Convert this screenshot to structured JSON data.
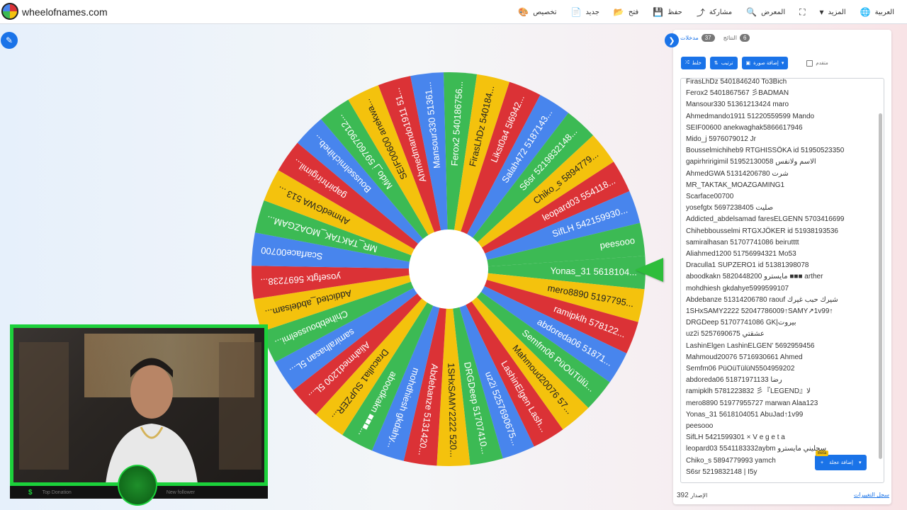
{
  "topbar": {
    "site_name": "wheelofnames.com",
    "menu": [
      {
        "label": "العربية",
        "icon": "globe-icon",
        "glyph": "🌐"
      },
      {
        "label": "المزيد",
        "icon": "chevron-down-icon",
        "glyph": "▾"
      },
      {
        "label": "",
        "icon": "fullscreen-icon",
        "glyph": "⛶"
      },
      {
        "label": "المعرض",
        "icon": "search-icon",
        "glyph": "🔍"
      },
      {
        "label": "مشاركة",
        "icon": "share-icon",
        "glyph": "⤴"
      },
      {
        "label": "حفظ",
        "icon": "save-icon",
        "glyph": "💾"
      },
      {
        "label": "فتح",
        "icon": "folder-open-icon",
        "glyph": "📂"
      },
      {
        "label": "جديد",
        "icon": "new-file-icon",
        "glyph": "📄"
      },
      {
        "label": "تخصيص",
        "icon": "palette-icon",
        "glyph": "🎨"
      }
    ]
  },
  "panel": {
    "tabs": {
      "entries_label": "مدخلات",
      "entries_count": "37",
      "results_label": "النتائج",
      "results_count": "6"
    },
    "toolbar": {
      "shuffle": "خلط",
      "sort": "ترتيب",
      "add_image": "إضافة صورة",
      "advanced": "متقدم"
    },
    "add_image_button": "إضافة عجلة",
    "beta_badge": "Beta",
    "version_label": "الإصدار",
    "version_number": "392",
    "changelog_link": "سجل التغييرات"
  },
  "entries_list": [
    "FirasLhDz 5401846240 To3Bich",
    "Ferox2 5401867567 彡BADMAN",
    "Mansour330 51361213424 maro",
    "Ahmedmando1911 51220559599 Mando",
    "SEIF00600 anekwaghak5866617946",
    "Mido_j 5976079012 Jr",
    "Bousselmichiheb9 RTGHISSÖKA id 51950523350",
    "gapirhririgimil 51952130058 الاسم ولانفس",
    "AhmedGWA 51314206780 شرت",
    "MR_TAKTAK_MOAZGAMING1",
    "Scarface00700",
    "yosefgtx 5697238405 صليت",
    "Addicted_abdelsamad faresELGENN 5703416699",
    "Chihebbousselmi RTGXJÖKER id 51938193536",
    "samiralhasan 51707741086 beirutttt",
    "Aliahmed1200 51756994321 Mo53",
    "Draculla1 SUPZERO1 id 51381398078",
    "aboodkakn 5820448200 مايسترو ■■■ arther",
    "mohdhiesh gkdahye5999599107",
    "Abdebanze 51314206780 raouf شيرك حبب غيرك",
    "1SHxSAMY2222 5204778600​9↑SAMY↗1v99↑",
    "DRGDeep 51707741086 GK|بيروت",
    "uz2i 5257690675 عشقتي",
    "LashinElgen LashinELGEN' 5692959456",
    "Mahmoud20076 5716930661 Ahmed",
    "Semfm06 PüOüTülüN5504959202",
    "abdoreda06 51871971133 رضا",
    "ramipklh 5781223832 彡『LEGEND』لا",
    "mero8890 51977955727 marwan Alaa123",
    "Yonas_31 5618104051 AbuJad↑1v99",
    "peesooo",
    "SifLH 5421599301 × V e g e t a",
    "leopard03 5541183332aybm سجليني مايسترو",
    "Chiko_s 5894779993 yamch",
    "S6sr 5219832148 | I5y"
  ],
  "wheel": {
    "colors": [
      "#3cba54",
      "#f4c20d",
      "#db3236",
      "#4885ed"
    ],
    "segments": [
      "Yonas_31  5618104...",
      "mero8890  5197795...",
      "ramipklh  578122...",
      "abdoreda06  51871...",
      "Semfm06  PüOüTülü...",
      "Mahmoud20076  57...",
      "LashinElgen  Lash...",
      "uz2i  5257690675...",
      "DRGDeep  51707410...",
      "1SHxSAMY2222  520...",
      "Abdebanze  5131420...",
      "mohdhiesh  gkdahy...",
      "aboodkakn  ■■■...",
      "Draculla1  SUPZER...",
      "Aliahmed1200  5L...",
      "samiralhasan  5L...",
      "Chihebbousselmi...",
      "Addicted_abdelsam...",
      "yosefgtx  5697238...",
      "Scarface00700",
      "MR_TAKTAK_MOAZGAM...",
      "AhmedGWA  513 ...",
      "gapirhririgimil...",
      "Bousselmichiheb...",
      "Mido_j  5976079012...",
      "SEIF00600  anekwa...",
      "Ahmedmando1911  51...",
      "Mansour330  51361...",
      "Ferox2  540186756...",
      "FirasLhDz  540184...",
      "Likst0a4  5l6942...",
      "Salah472  5187143...",
      "S6sr  5219832148...",
      "Chiko_s  5894779...",
      "leopard03  554118...",
      "SifLH  542159930...",
      "peesooo"
    ]
  },
  "webcam": {
    "bar_donation": "Top Donation",
    "bar_follower": "New follower",
    "bar_dollar": "$"
  }
}
